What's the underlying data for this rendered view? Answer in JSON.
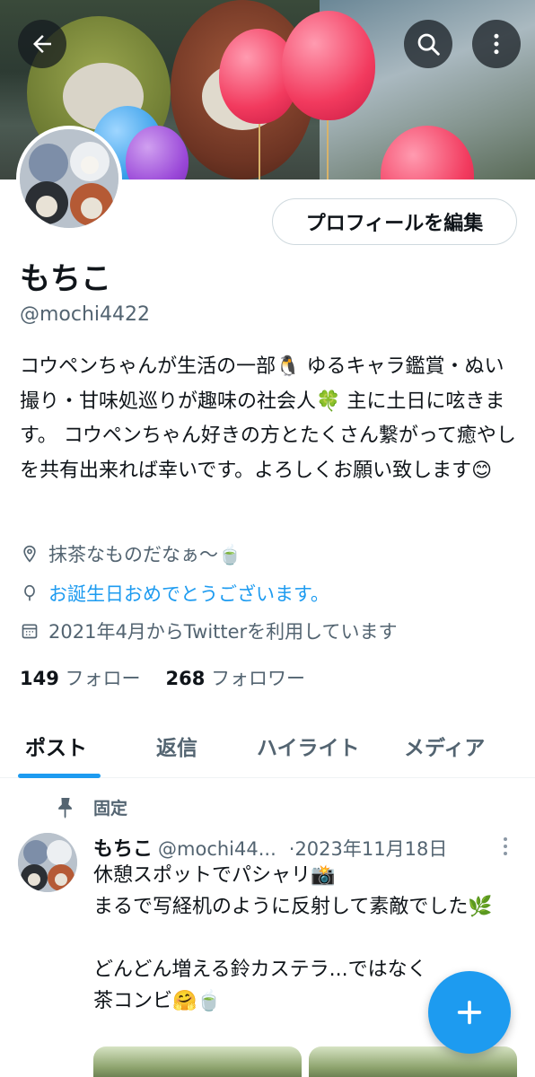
{
  "profile": {
    "name": "もちこ",
    "handle": "@mochi4422",
    "edit_label": "プロフィールを編集",
    "bio": "コウペンちゃんが生活の一部🐧 ゆるキャラ鑑賞・ぬい撮り・甘味処巡りが趣味の社会人🍀 主に土日に呟きます。 コウペンちゃん好きの方とたくさん繋がって癒やしを共有出来れば幸いです。よろしくお願い致します😊",
    "location": "抹茶なものだなぁ〜🍵",
    "birthday": "お誕生日おめでとうございます。",
    "joined": "2021年4月からTwitterを利用しています",
    "following_count": "149",
    "following_label": "フォロー",
    "followers_count": "268",
    "followers_label": "フォロワー"
  },
  "tabs": [
    {
      "label": "ポスト",
      "active": true
    },
    {
      "label": "返信",
      "active": false
    },
    {
      "label": "ハイライト",
      "active": false
    },
    {
      "label": "メディア",
      "active": false
    }
  ],
  "pinned_label": "固定",
  "tweet": {
    "name": "もちこ",
    "handle": "@mochi44...",
    "date": "·2023年11月18日",
    "line1": "休憩スポットでパシャリ📸",
    "line2": "まるで写経机のように反射して素敵でした🌿",
    "line3": "どんどん増える鈴カステラ...ではなく",
    "line4": "茶コンビ🤗🍵"
  },
  "icons": {
    "back": "back-arrow-icon",
    "search": "search-icon",
    "more": "more-vertical-icon",
    "location": "location-pin-icon",
    "birthday": "balloon-icon",
    "calendar": "calendar-icon",
    "pin": "pin-icon",
    "fab": "plus-icon"
  },
  "colors": {
    "accent": "#1d9bf0",
    "text": "#0f1419",
    "secondary": "#536471"
  }
}
